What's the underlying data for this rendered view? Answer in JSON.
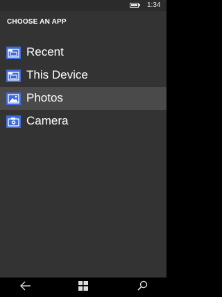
{
  "status_bar": {
    "time": "1:34",
    "battery_icon": "battery-icon"
  },
  "header": {
    "title": "CHOOSE AN APP"
  },
  "apps": [
    {
      "label": "Recent",
      "icon": "folder-icon"
    },
    {
      "label": "This Device",
      "icon": "folder-icon"
    },
    {
      "label": "Photos",
      "icon": "photos-icon",
      "selected": true
    },
    {
      "label": "Camera",
      "icon": "camera-icon"
    }
  ],
  "nav_bar": {
    "back_icon": "back-arrow-icon",
    "start_icon": "windows-logo-icon",
    "search_icon": "search-icon"
  },
  "colors": {
    "background": "#333333",
    "selected_row": "#4a4a4a",
    "icon_tile": "#3f6cdd",
    "nav_bar": "#000000",
    "text": "#ffffff"
  }
}
